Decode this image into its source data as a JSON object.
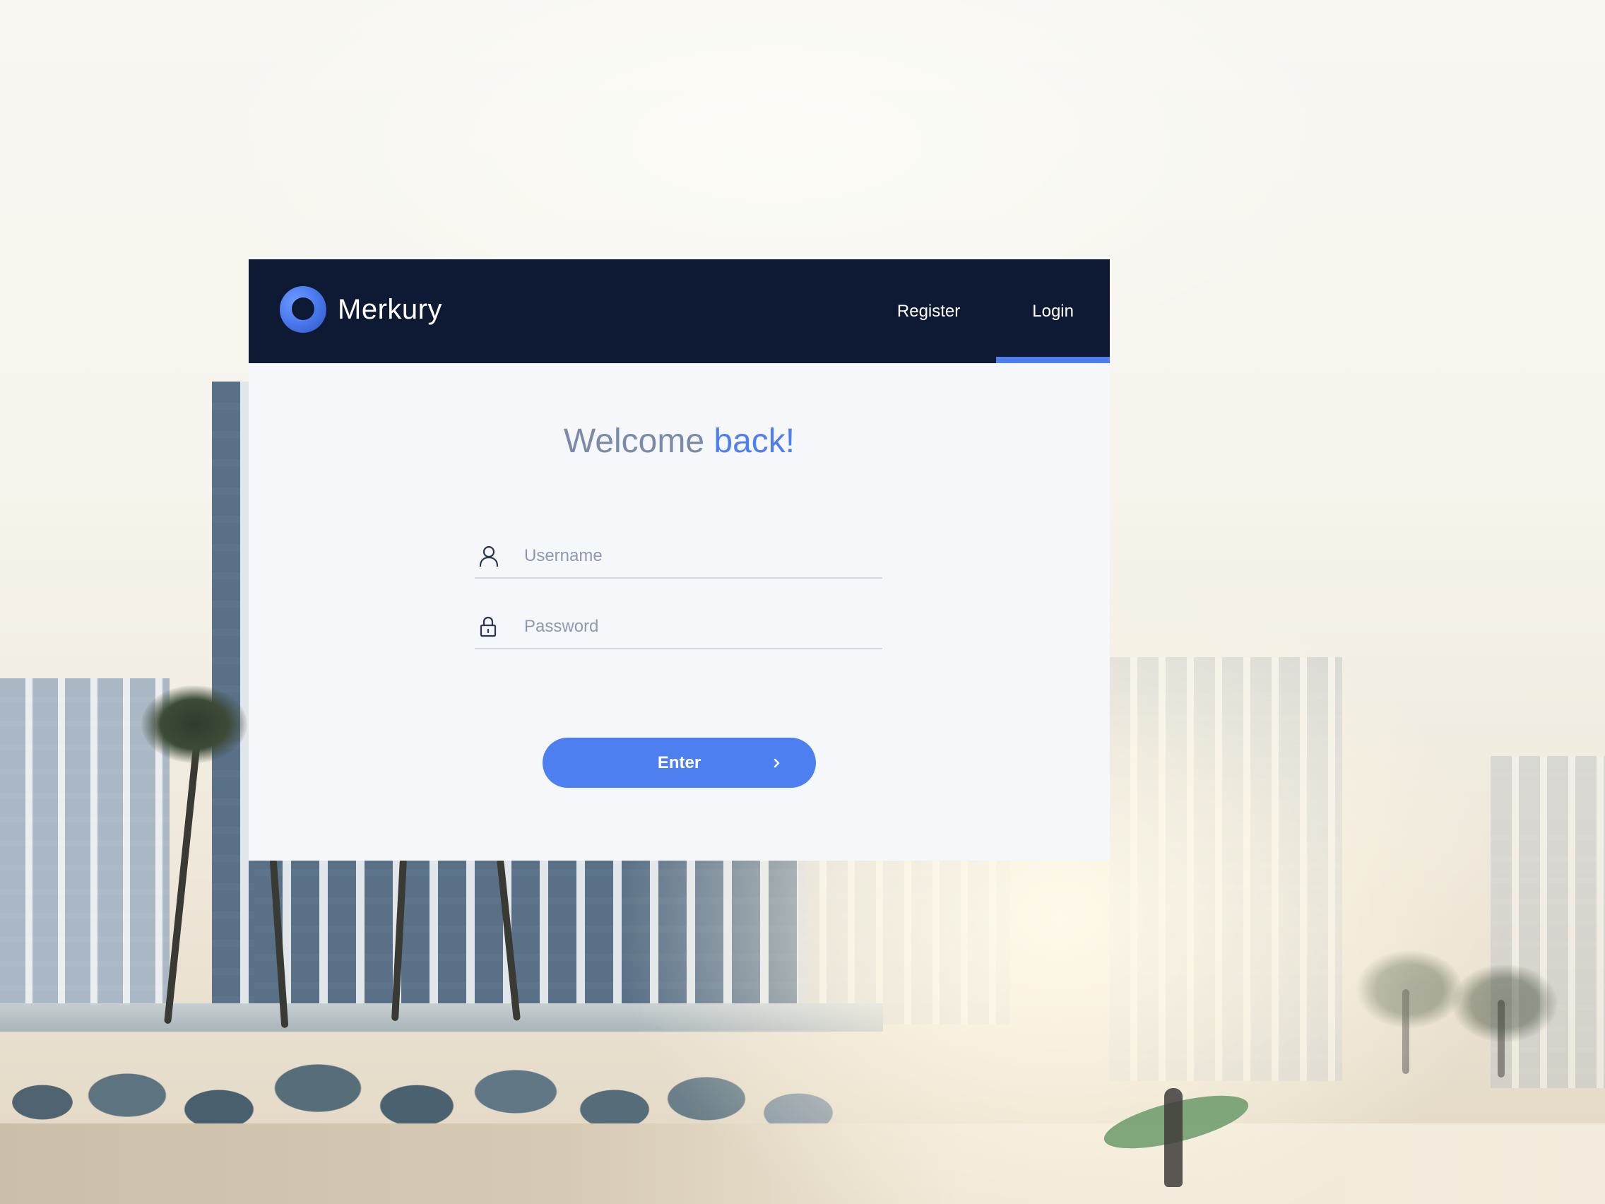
{
  "brand": {
    "name": "Merkury",
    "logo_icon": "ring-logo-icon"
  },
  "nav": {
    "items": [
      {
        "label": "Register",
        "active": false
      },
      {
        "label": "Login",
        "active": true
      }
    ]
  },
  "login": {
    "heading_main": "Welcome",
    "heading_accent": "back!",
    "username": {
      "placeholder": "Username",
      "value": "",
      "icon": "user-icon"
    },
    "password": {
      "placeholder": "Password",
      "value": "",
      "icon": "lock-icon"
    },
    "submit_label": "Enter",
    "submit_icon": "chevron-right-icon"
  },
  "colors": {
    "accent": "#4e7ff0",
    "topbar": "#0e1933",
    "card": "#f5f7fb",
    "heading": "#7b8aa6"
  }
}
